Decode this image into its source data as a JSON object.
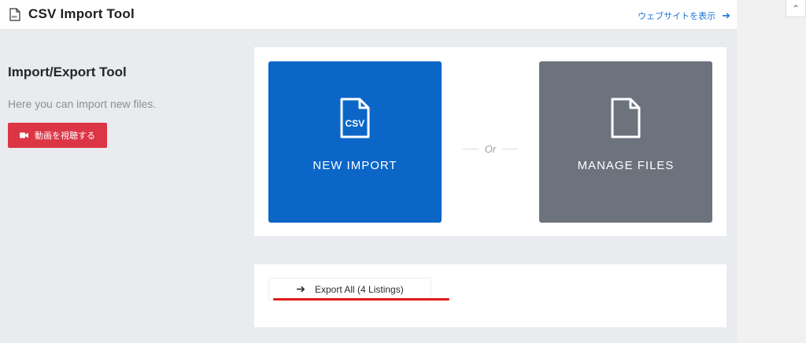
{
  "header": {
    "title": "CSV Import Tool",
    "site_link": "ウェブサイトを表示",
    "site_link_arrow": "➔"
  },
  "sidebar": {
    "heading": "Import/Export Tool",
    "description": "Here you can import new files.",
    "video_button": "動画を視聴する"
  },
  "actions": {
    "new_import": "NEW IMPORT",
    "separator": "Or",
    "manage_files": "MANAGE FILES",
    "csv_badge": "CSV"
  },
  "export": {
    "arrow": "➔",
    "label": "Export All (4 Listings)"
  },
  "colors": {
    "import_tile": "#0b66c8",
    "manage_tile": "#6d737c",
    "video_button": "#dc3545",
    "link": "#1e73d6",
    "annotation": "#e31b1b"
  }
}
